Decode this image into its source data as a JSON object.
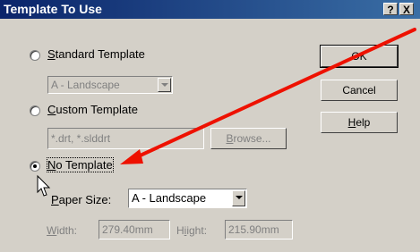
{
  "dialog": {
    "title": "Template To Use",
    "help_glyph": "?",
    "close_glyph": "X"
  },
  "options": {
    "standard": {
      "label": "Standard Template",
      "selected": false,
      "dropdown_value": "A - Landscape"
    },
    "custom": {
      "label": "Custom Template",
      "selected": false,
      "field_value": "*.drt, *.slddrt",
      "browse_label": "Browse..."
    },
    "none": {
      "label": "No Template",
      "selected": true
    }
  },
  "paper": {
    "size_label": "Paper Size:",
    "size_value": "A - Landscape",
    "width_label": "Width:",
    "width_value": "279.40mm",
    "height_label": "Height:",
    "height_value": "215.90mm"
  },
  "buttons": {
    "ok": "OK",
    "cancel": "Cancel",
    "help": "Help"
  },
  "annotation": {
    "arrow_color": "#ee1100"
  }
}
